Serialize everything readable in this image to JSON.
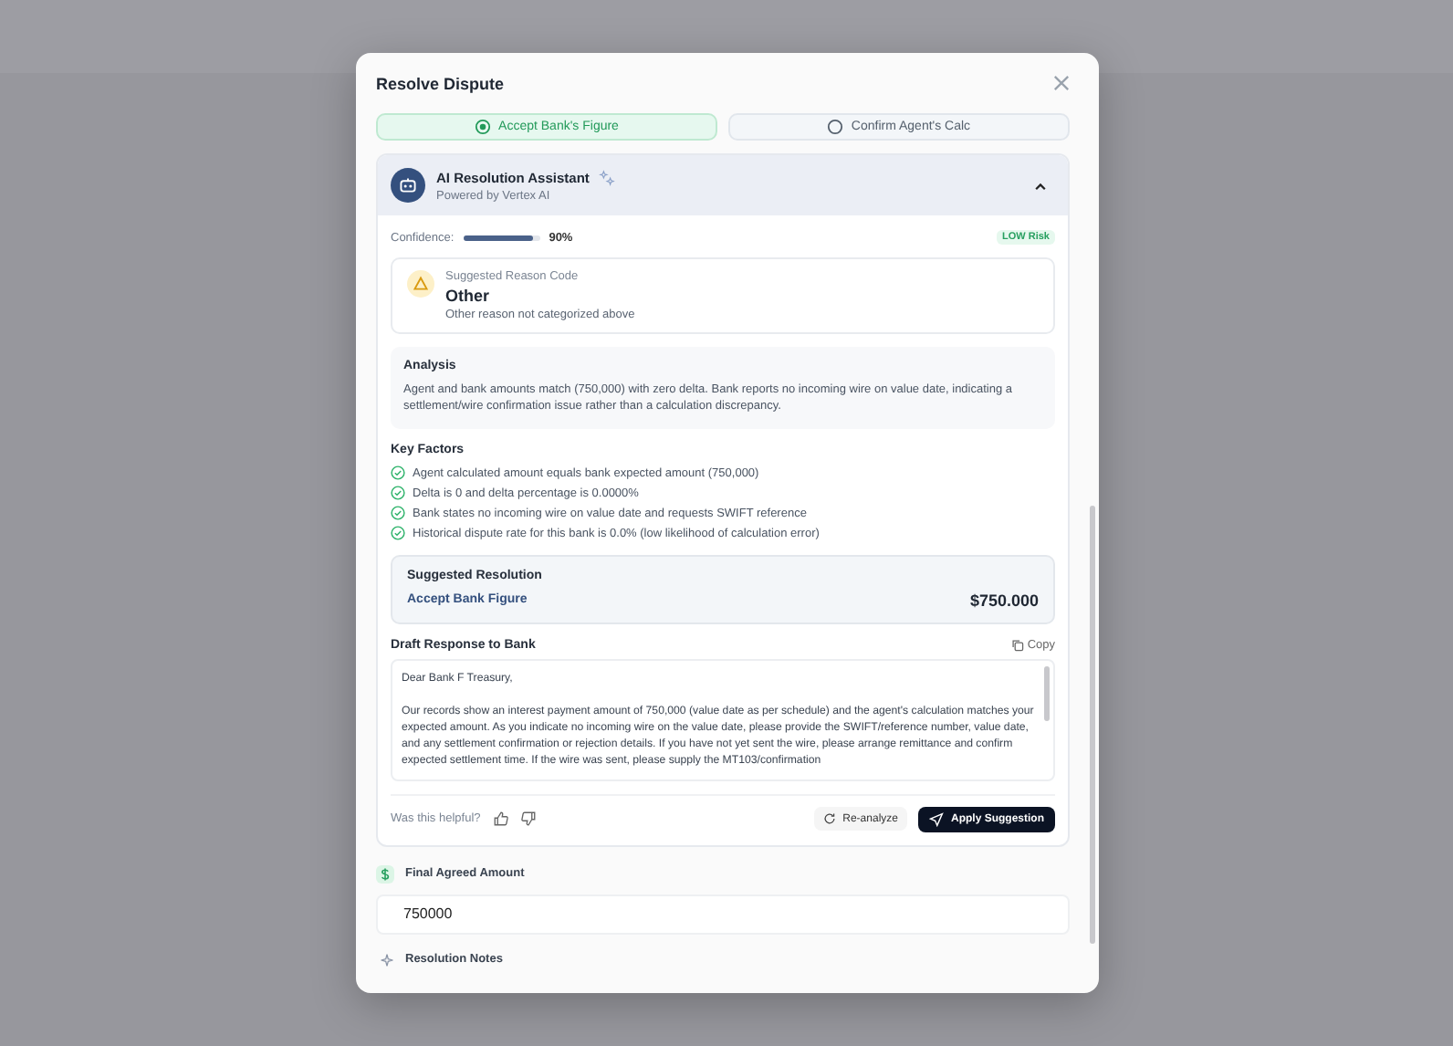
{
  "dialog": {
    "title": "Resolve Dispute"
  },
  "options": [
    {
      "label": "Accept Bank's Figure",
      "selected": true
    },
    {
      "label": "Confirm Agent's Calc",
      "selected": false
    }
  ],
  "assistant": {
    "title": "AI Resolution Assistant",
    "subtitle": "Powered by Vertex AI",
    "expanded": true,
    "confidence_label": "Confidence:",
    "confidence": {
      "level": 0.9,
      "reading": "90%"
    },
    "risk": "LOW Risk",
    "reason": {
      "label": "Suggested Reason Code",
      "value": "Other",
      "description": "Other reason not categorized above"
    },
    "analysis": {
      "title": "Analysis",
      "text": "Agent and bank amounts match (750,000) with zero delta. Bank reports no incoming wire on value date, indicating a settlement/wire confirmation issue rather than a calculation discrepancy."
    },
    "key_factors": {
      "title": "Key Factors",
      "items": [
        "Agent calculated amount equals bank expected amount (750,000)",
        "Delta is 0 and delta percentage is 0.0000%",
        "Bank states no incoming wire on value date and requests SWIFT reference",
        "Historical dispute rate for this bank is 0.0% (low likelihood of calculation error)"
      ]
    },
    "suggested": {
      "title": "Suggested Resolution",
      "action": "Accept Bank Figure",
      "amount": "$750.000"
    },
    "draft": {
      "title": "Draft Response to Bank",
      "copy": "Copy",
      "greeting": "Dear Bank F Treasury,",
      "body": "Our records show an interest payment amount of 750,000 (value date as per schedule) and the agent's calculation matches your expected amount. As you indicate no incoming wire on the value date, please provide the SWIFT/reference number, value date, and any settlement confirmation or rejection details. If you have not yet sent the wire, please arrange remittance and confirm expected settlement time. If the wire was sent, please supply the MT103/confirmation"
    },
    "feedback": "Was this helpful?",
    "reanalyze": "Re-analyze",
    "apply": "Apply Suggestion"
  },
  "final_amount": {
    "label": "Final Agreed Amount",
    "value": "750000"
  },
  "notes": {
    "label": "Resolution Notes"
  }
}
